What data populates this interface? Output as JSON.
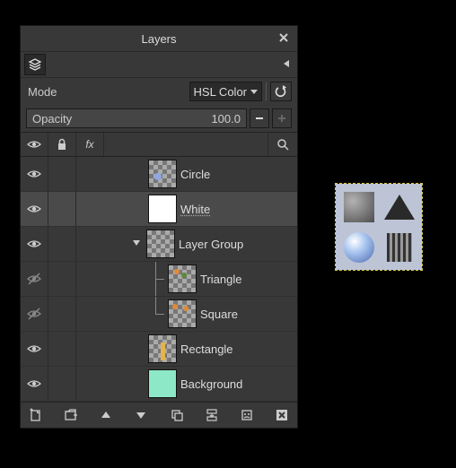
{
  "window": {
    "title": "Layers"
  },
  "mode": {
    "label": "Mode",
    "value": "HSL Color"
  },
  "opacity": {
    "label": "Opacity",
    "value": "100.0"
  },
  "headers": {
    "fx": "fx"
  },
  "layers": [
    {
      "name": "Circle",
      "visible": true,
      "indent": 1,
      "thumb": "checker-blue",
      "selected": false,
      "group": false,
      "child": false
    },
    {
      "name": "White",
      "visible": true,
      "indent": 1,
      "thumb": "white",
      "selected": true,
      "group": false,
      "child": false
    },
    {
      "name": "Layer Group",
      "visible": true,
      "indent": 1,
      "thumb": "checker",
      "selected": false,
      "group": true,
      "child": false
    },
    {
      "name": "Triangle",
      "visible": false,
      "indent": 2,
      "thumb": "checker-or1",
      "selected": false,
      "group": false,
      "child": true,
      "last": false
    },
    {
      "name": "Square",
      "visible": false,
      "indent": 2,
      "thumb": "checker-or2",
      "selected": false,
      "group": false,
      "child": true,
      "last": true
    },
    {
      "name": "Rectangle",
      "visible": true,
      "indent": 1,
      "thumb": "checker-bar",
      "selected": false,
      "group": false,
      "child": false
    },
    {
      "name": "Background",
      "visible": true,
      "indent": 1,
      "thumb": "mint",
      "selected": false,
      "group": false,
      "child": false
    }
  ]
}
